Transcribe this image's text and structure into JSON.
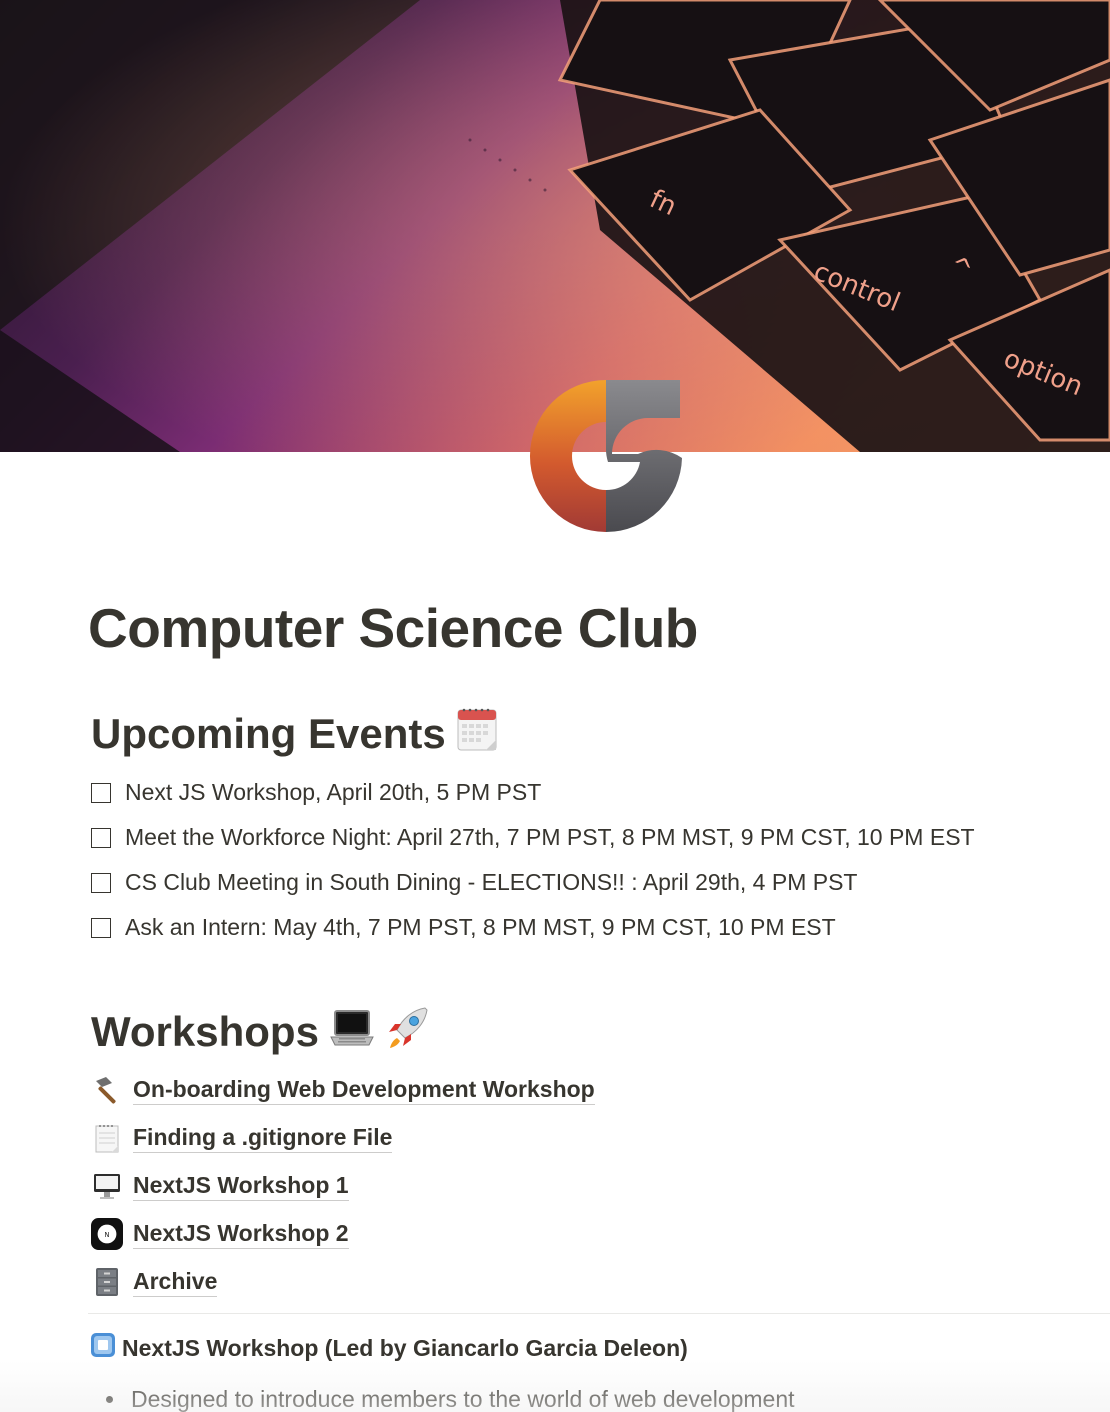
{
  "cover": {
    "key_labels": [
      "fn",
      "control",
      "option",
      "^"
    ]
  },
  "page_icon": "cs-club-logo",
  "title": "Computer Science Club",
  "upcoming_events": {
    "heading": "Upcoming Events",
    "heading_icon": "calendar-icon",
    "items": [
      {
        "label": "Next JS Workshop, April 20th, 5 PM PST",
        "checked": false
      },
      {
        "label": "Meet the Workforce Night: April 27th, 7 PM PST, 8 PM MST, 9 PM CST, 10 PM EST",
        "checked": false
      },
      {
        "label": "CS Club Meeting in South Dining - ELECTIONS!! : April 29th, 4 PM PST",
        "checked": false
      },
      {
        "label": "Ask an Intern: May 4th, 7 PM PST, 8 PM MST, 9 PM CST, 10 PM EST",
        "checked": false
      }
    ]
  },
  "workshops": {
    "heading": "Workshops",
    "heading_icons": [
      "laptop-icon",
      "rocket-icon"
    ],
    "links": [
      {
        "label": "On-boarding Web Development Workshop",
        "icon": "hammer-icon"
      },
      {
        "label": "Finding a .gitignore File",
        "icon": "notepad-icon"
      },
      {
        "label": "NextJS Workshop 1",
        "icon": "desktop-computer-icon"
      },
      {
        "label": "NextJS Workshop 2",
        "icon": "nextjs-logo-icon"
      },
      {
        "label": "Archive",
        "icon": "file-cabinet-icon"
      }
    ]
  },
  "nextjs_section": {
    "heading": "NextJS Workshop (Led by Giancarlo Garcia Deleon)",
    "heading_icon": "stop-button-icon",
    "bullets": [
      "Designed to introduce members to the world of web development"
    ]
  }
}
